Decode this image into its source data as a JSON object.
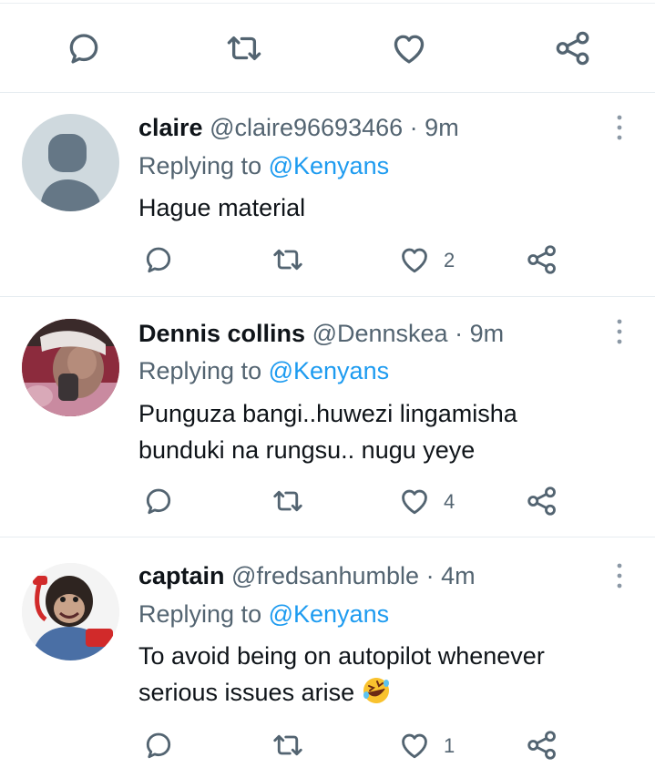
{
  "top_actions": {
    "icons": [
      "reply-icon",
      "retweet-icon",
      "like-icon",
      "share-icon"
    ]
  },
  "tweets": [
    {
      "display_name": "claire",
      "handle": "@claire96693466",
      "separator": "·",
      "time": "9m",
      "replying_prefix": "Replying to",
      "replying_to": "@Kenyans",
      "text": "Hague material",
      "text_line2": "",
      "like_count": "2",
      "avatar": "default-avatar"
    },
    {
      "display_name": "Dennis collins",
      "handle": "@Dennskea",
      "separator": "·",
      "time": "9m",
      "replying_prefix": "Replying to",
      "replying_to": "@Kenyans",
      "text": "Punguza bangi..huwezi lingamisha",
      "text_line2": "bunduki na rungsu.. nugu yeye",
      "like_count": "4",
      "avatar": "photo-avatar"
    },
    {
      "display_name": "captain",
      "handle": "@fredsanhumble",
      "separator": "·",
      "time": "4m",
      "replying_prefix": "Replying to",
      "replying_to": "@Kenyans",
      "text": "To avoid being on autopilot whenever",
      "text_line2": "serious issues arise",
      "emoji": "rolling-on-floor-laughing-emoji",
      "like_count": "1",
      "avatar": "chimp-avatar"
    }
  ],
  "colors": {
    "text_primary": "#0f1419",
    "text_secondary": "#536471",
    "accent": "#1d9bf0",
    "divider": "#e6ecf0"
  }
}
